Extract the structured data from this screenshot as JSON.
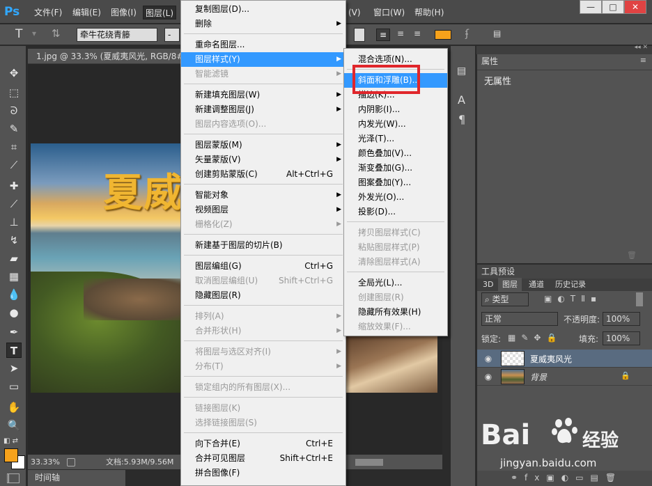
{
  "menubar": {
    "logo": "Ps",
    "items": [
      "文件(F)",
      "编辑(E)",
      "图像(I)",
      "图层(L)",
      "(V)",
      "窗口(W)",
      "帮助(H)"
    ],
    "window_buttons": [
      "—",
      "□",
      "✕"
    ]
  },
  "options_bar": {
    "font_family": "牵牛花绕青籐",
    "font_style": "-",
    "color_swatch": "#f7a21b"
  },
  "document": {
    "tab_title": "1.jpg @ 33.3% (夏威夷风光, RGB/8#)",
    "canvas_text": "夏威",
    "zoom": "33.33%",
    "doc_info": "文档:5.93M/9.56M"
  },
  "timeline_tab": "时间轴",
  "toolbar": {
    "colors": {
      "foreground": "#f7a21b",
      "background": "#ffffff"
    }
  },
  "layer_menu": {
    "items": [
      {
        "label": "复制图层(D)...",
        "enabled": true,
        "submenu": false
      },
      {
        "label": "删除",
        "enabled": true,
        "submenu": true
      },
      {
        "label": "重命名图层...",
        "enabled": true,
        "submenu": false
      },
      {
        "label": "图层样式(Y)",
        "enabled": true,
        "submenu": true,
        "highlighted": true
      },
      {
        "label": "智能滤镜",
        "enabled": false,
        "submenu": true
      },
      {
        "label": "新建填充图层(W)",
        "enabled": true,
        "submenu": true
      },
      {
        "label": "新建调整图层(J)",
        "enabled": true,
        "submenu": true
      },
      {
        "label": "图层内容选项(O)...",
        "enabled": false,
        "submenu": false
      },
      {
        "label": "图层蒙版(M)",
        "enabled": true,
        "submenu": true
      },
      {
        "label": "矢量蒙版(V)",
        "enabled": true,
        "submenu": true
      },
      {
        "label": "创建剪贴蒙版(C)",
        "shortcut": "Alt+Ctrl+G",
        "enabled": true,
        "submenu": false
      },
      {
        "label": "智能对象",
        "enabled": true,
        "submenu": true
      },
      {
        "label": "视频图层",
        "enabled": true,
        "submenu": true
      },
      {
        "label": "栅格化(Z)",
        "enabled": false,
        "submenu": true
      },
      {
        "label": "新建基于图层的切片(B)",
        "enabled": true,
        "submenu": false
      },
      {
        "label": "图层编组(G)",
        "shortcut": "Ctrl+G",
        "enabled": true,
        "submenu": false
      },
      {
        "label": "取消图层编组(U)",
        "shortcut": "Shift+Ctrl+G",
        "enabled": false,
        "submenu": false
      },
      {
        "label": "隐藏图层(R)",
        "enabled": true,
        "submenu": false
      },
      {
        "label": "排列(A)",
        "enabled": false,
        "submenu": true
      },
      {
        "label": "合并形状(H)",
        "enabled": false,
        "submenu": true
      },
      {
        "label": "将图层与选区对齐(I)",
        "enabled": false,
        "submenu": true
      },
      {
        "label": "分布(T)",
        "enabled": false,
        "submenu": true
      },
      {
        "label": "锁定组内的所有图层(X)...",
        "enabled": false,
        "submenu": false
      },
      {
        "label": "链接图层(K)",
        "enabled": false,
        "submenu": false
      },
      {
        "label": "选择链接图层(S)",
        "enabled": false,
        "submenu": false
      },
      {
        "label": "向下合并(E)",
        "shortcut": "Ctrl+E",
        "enabled": true,
        "submenu": false
      },
      {
        "label": "合并可见图层",
        "shortcut": "Shift+Ctrl+E",
        "enabled": true,
        "submenu": false
      },
      {
        "label": "拼合图像(F)",
        "enabled": true,
        "submenu": false
      }
    ]
  },
  "style_submenu": {
    "items": [
      {
        "label": "混合选项(N)...",
        "enabled": true
      },
      {
        "label": "斜面和浮雕(B)...",
        "enabled": true,
        "highlighted": true
      },
      {
        "label": "描边(K)...",
        "enabled": true
      },
      {
        "label": "内阴影(I)...",
        "enabled": true
      },
      {
        "label": "内发光(W)...",
        "enabled": true
      },
      {
        "label": "光泽(T)...",
        "enabled": true
      },
      {
        "label": "颜色叠加(V)...",
        "enabled": true
      },
      {
        "label": "渐变叠加(G)...",
        "enabled": true
      },
      {
        "label": "图案叠加(Y)...",
        "enabled": true
      },
      {
        "label": "外发光(O)...",
        "enabled": true
      },
      {
        "label": "投影(D)...",
        "enabled": true
      },
      {
        "label": "拷贝图层样式(C)",
        "enabled": false
      },
      {
        "label": "粘贴图层样式(P)",
        "enabled": false
      },
      {
        "label": "清除图层样式(A)",
        "enabled": false
      },
      {
        "label": "全局光(L)...",
        "enabled": true
      },
      {
        "label": "创建图层(R)",
        "enabled": false
      },
      {
        "label": "隐藏所有效果(H)",
        "enabled": true
      },
      {
        "label": "缩放效果(F)...",
        "enabled": false
      }
    ]
  },
  "properties_panel": {
    "title": "属性",
    "content": "无属性"
  },
  "tool_presets_panel": {
    "title": "工具预设"
  },
  "layers_panel": {
    "tabs": [
      "3D",
      "图层",
      "通道",
      "历史记录"
    ],
    "active_tab": "图层",
    "filter_kind": "类型",
    "blend_mode": "正常",
    "opacity_label": "不透明度:",
    "opacity": "100%",
    "lock_label": "锁定:",
    "fill_label": "填充:",
    "fill": "100%",
    "layers": [
      {
        "name": "夏威夷风光",
        "selected": true
      },
      {
        "name": "背景",
        "selected": false,
        "locked": true
      }
    ]
  },
  "watermark": {
    "brand": "Bai",
    "brand2": "经验",
    "url": "jingyan.baidu.com"
  }
}
